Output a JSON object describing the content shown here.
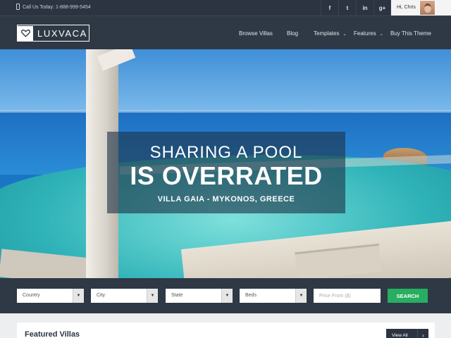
{
  "topbar": {
    "phone_text": "Call Us Today: 1-888-999-5454",
    "social": [
      "f",
      "t",
      "in",
      "g+"
    ],
    "user_greeting": "Hi, Chris"
  },
  "header": {
    "logo_text": "LUXVACA",
    "nav": [
      {
        "label": "Browse Villas",
        "caret": ""
      },
      {
        "label": "Blog",
        "caret": ""
      },
      {
        "label": "Templates",
        "caret": "⌄"
      },
      {
        "label": "Features",
        "caret": "⌄"
      },
      {
        "label": "Buy This Theme",
        "caret": ""
      }
    ]
  },
  "hero": {
    "line1": "SHARING A POOL",
    "line2": "IS OVERRATED",
    "line3": "VILLA GAIA - MYKONOS, GREECE"
  },
  "search": {
    "selects": [
      "Country",
      "City",
      "State",
      "Beds"
    ],
    "arrow": "▼",
    "price_placeholder": "Price From ($)",
    "button": "SEARCH"
  },
  "featured": {
    "title": "Featured Villas",
    "view_all": "View All",
    "view_all_chevron": "›"
  },
  "colors": {
    "dark": "#2f3945",
    "topbar": "#2b3440",
    "accent_green": "#27ae60"
  }
}
